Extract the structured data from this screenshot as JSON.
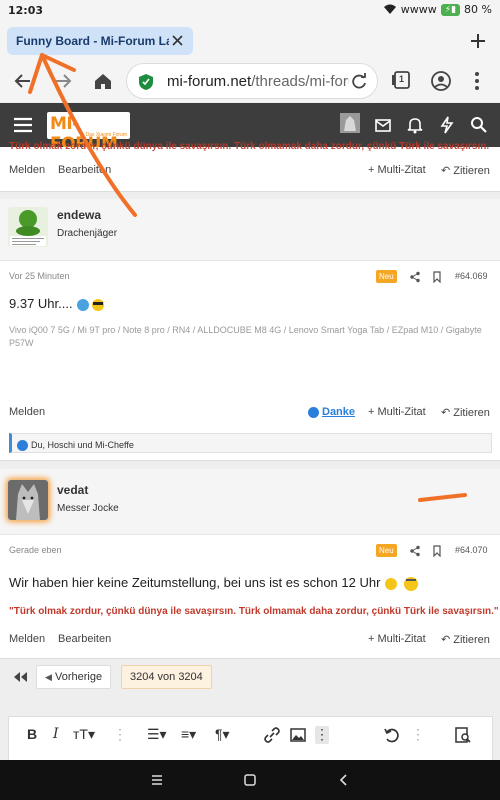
{
  "status_bar": {
    "time": "12:03",
    "carrier": "wwww",
    "battery": "80 %"
  },
  "tab": {
    "title": "Funny Board - Mi-Forum Lab"
  },
  "address_bar": {
    "host": "mi-forum.net",
    "path": "/threads/mi-foru",
    "tabs_count": "1"
  },
  "site": {
    "logo_text": "MI-FORUM",
    "logo_tag": "Das Xiaomi Forum"
  },
  "top_post": {
    "signature": "Türk olmak zordur, çünkü dünya ile savaşırsın. Türk olmamak daha zordur, çünkü Türk ile savaşırsın.",
    "actions": {
      "report": "Melden",
      "edit": "Bearbeiten",
      "multiquote": "Multi-Zitat",
      "quote": "Zitieren"
    }
  },
  "post1": {
    "username": "endewa",
    "user_title": "Drachenjäger",
    "time": "Vor 25 Minuten",
    "badge": "Neu",
    "number": "#64.069",
    "text": "9.37 Uhr....",
    "devices": "Vivo iQ00 7 5G / Mi 9T pro / Note 8 pro / RN4 / ALLDOCUBE M8 4G / Lenovo Smart Yoga Tab / EZpad M10 / Gigabyte P57W",
    "actions": {
      "report": "Melden",
      "like": "Danke",
      "multiquote": "Multi-Zitat",
      "quote": "Zitieren"
    },
    "likes": "Du, Hoschi und Mi-Cheffe"
  },
  "post2": {
    "username": "vedat",
    "user_title": "Messer Jocke",
    "time": "Gerade eben",
    "badge": "Neu",
    "number": "#64.070",
    "text": "Wir haben hier keine Zeitumstellung, bei uns ist es schon 12 Uhr",
    "signature": "\"Türk olmak zordur, çünkü dünya ile savaşırsın. Türk olmamak daha zordur, çünkü Türk ile savaşırsın.\"",
    "actions": {
      "report": "Melden",
      "edit": "Bearbeiten",
      "multiquote": "Multi-Zitat",
      "quote": "Zitieren"
    }
  },
  "pagination": {
    "prev": "Vorherige",
    "current": "3204 von 3204"
  },
  "colors": {
    "accent": "#f38a16",
    "header_bg": "#3d3d3d",
    "link": "#2b7fdb",
    "signature": "#c0392b",
    "annotation": "#f07028"
  }
}
